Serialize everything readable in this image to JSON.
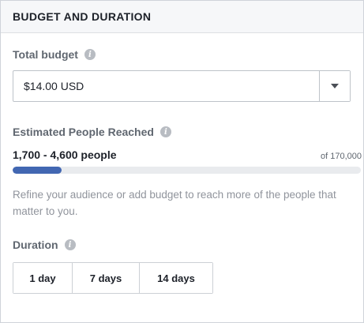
{
  "header": {
    "title": "BUDGET AND DURATION"
  },
  "budget": {
    "label": "Total budget",
    "value": "$14.00 USD",
    "info_icon": "info-icon",
    "dropdown_icon": "caret-down-icon"
  },
  "reach": {
    "label": "Estimated People Reached",
    "range": "1,700 - 4,600 people",
    "max": "of 170,000",
    "progress_fraction": 0.14,
    "bar_color": "#4267b2",
    "track_color": "#e9ebee"
  },
  "hint": "Refine your audience or add budget to reach more of the people that matter to you.",
  "duration": {
    "label": "Duration",
    "options": [
      "1 day",
      "7 days",
      "14 days"
    ]
  }
}
